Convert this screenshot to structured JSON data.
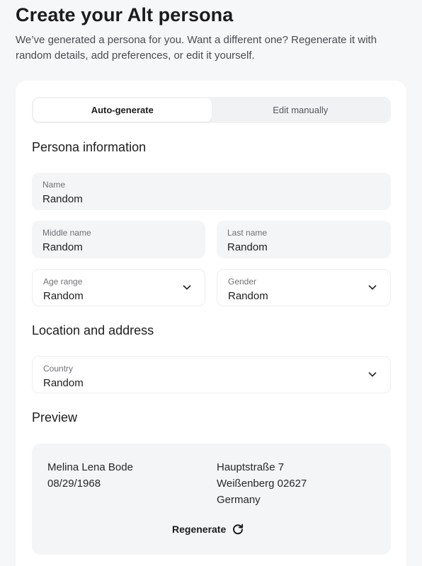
{
  "header": {
    "title": "Create your Alt persona",
    "subtitle": "We’ve generated a persona for you. Want a different one? Regenerate it with random details, add preferences, or edit it yourself."
  },
  "mode_tabs": [
    {
      "label": "Auto-generate",
      "active": true
    },
    {
      "label": "Edit manually",
      "active": false
    }
  ],
  "persona_section": {
    "heading": "Persona information",
    "name": {
      "label": "Name",
      "value": "Random"
    },
    "middle_name": {
      "label": "Middle name",
      "value": "Random"
    },
    "last_name": {
      "label": "Last name",
      "value": "Random"
    },
    "age_range": {
      "label": "Age range",
      "value": "Random",
      "icon": "chevron-down-icon"
    },
    "gender": {
      "label": "Gender",
      "value": "Random",
      "icon": "chevron-down-icon"
    }
  },
  "location_section": {
    "heading": "Location and address",
    "country": {
      "label": "Country",
      "value": "Random",
      "icon": "chevron-down-icon"
    }
  },
  "preview": {
    "heading": "Preview",
    "full_name": "Melina Lena Bode",
    "birth_date": "08/29/1968",
    "street": "Hauptstraße 7",
    "city_zip": "Weißenberg 02627",
    "country": "Germany",
    "regenerate_label": "Regenerate",
    "regenerate_icon": "refresh-icon"
  }
}
